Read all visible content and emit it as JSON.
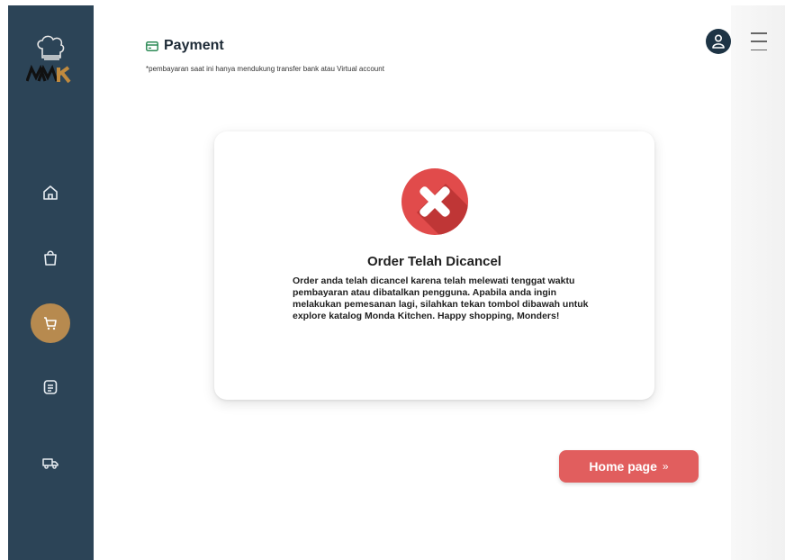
{
  "brand": {
    "logo_text": "MK"
  },
  "header": {
    "title": "Payment",
    "note": "*pembayaran saat ini hanya mendukung transfer bank atau Virtual account"
  },
  "sidebar": {
    "items": [
      {
        "icon": "home-icon"
      },
      {
        "icon": "shopping-bag-icon"
      },
      {
        "icon": "cart-icon",
        "active": true
      },
      {
        "icon": "receipt-icon"
      },
      {
        "icon": "delivery-truck-icon"
      }
    ]
  },
  "card": {
    "title": "Order Telah Dicancel",
    "body": "Order anda telah dicancel karena telah melewati tenggat waktu pembayaran atau dibatalkan pengguna. Apabila anda ingin melakukan pemesanan lagi, silahkan tekan tombol dibawah untuk explore katalog Monda Kitchen. Happy shopping, Monders!"
  },
  "actions": {
    "home_label": "Home page",
    "home_arrow": "»"
  },
  "colors": {
    "sidebar": "#2c4457",
    "accent_gold": "#b78a4f",
    "cancel_red": "#e14b4b",
    "button_red": "#e15e5e"
  }
}
